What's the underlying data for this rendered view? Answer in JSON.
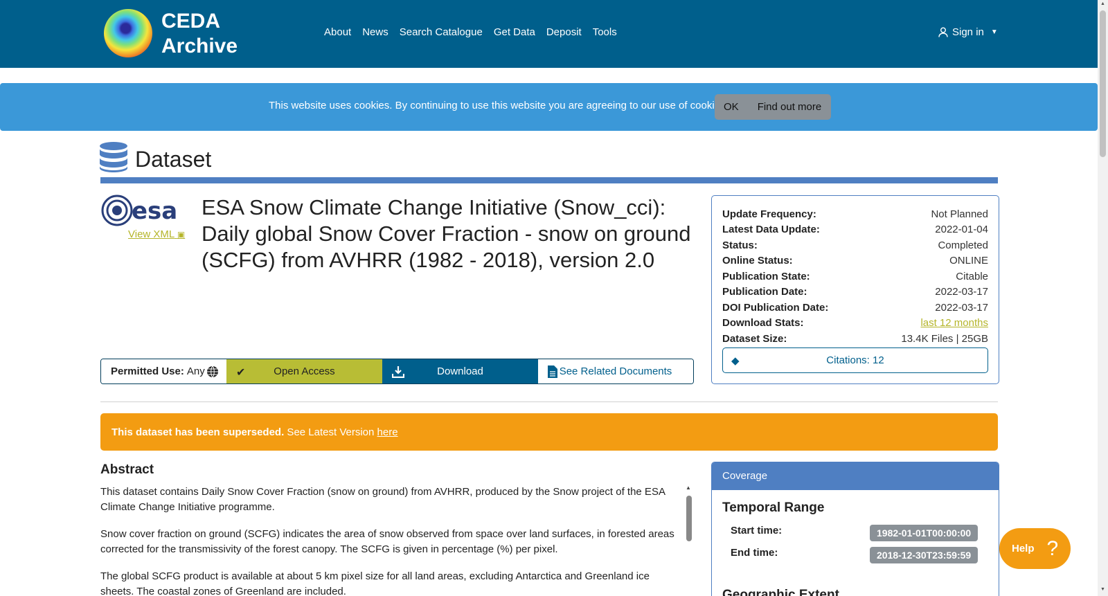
{
  "navbar": {
    "brand_line1": "CEDA",
    "brand_line2": "Archive",
    "links": [
      "About",
      "News",
      "Search Catalogue",
      "Get Data",
      "Deposit",
      "Tools"
    ],
    "signin": "Sign in"
  },
  "cookie": {
    "text": "This website uses cookies. By continuing to use this website you are agreeing to our use of cookies.",
    "ok": "OK",
    "find_out_more": "Find out more"
  },
  "dataset": {
    "heading": "Dataset",
    "view_xml": "View XML",
    "title": "ESA Snow Climate Change Initiative (Snow_cci): Daily global Snow Cover Fraction - snow on ground (SCFG) from AVHRR (1982 - 2018), version 2.0"
  },
  "actions": {
    "permitted_label": "Permitted Use:",
    "permitted_value": "Any",
    "open_access": "Open Access",
    "download": "Download",
    "related_docs": "See Related Documents"
  },
  "info": {
    "rows": [
      {
        "label": "Update Frequency:",
        "value": "Not Planned"
      },
      {
        "label": "Latest Data Update:",
        "value": "2022-01-04"
      },
      {
        "label": "Status:",
        "value": "Completed"
      },
      {
        "label": "Online Status:",
        "value": "ONLINE"
      },
      {
        "label": "Publication State:",
        "value": "Citable"
      },
      {
        "label": "Publication Date:",
        "value": "2022-03-17"
      },
      {
        "label": "DOI Publication Date:",
        "value": "2022-03-17"
      },
      {
        "label": "Download Stats:",
        "value": "last 12 months"
      },
      {
        "label": "Dataset Size:",
        "value": "13.4K Files | 25GB"
      }
    ],
    "citations": "Citations: 12"
  },
  "superseded": {
    "bold": "This dataset has been superseded.",
    "text": " See Latest Version ",
    "link": "here"
  },
  "abstract": {
    "heading": "Abstract",
    "paragraphs": [
      "This dataset contains Daily Snow Cover Fraction (snow on ground) from AVHRR, produced by the Snow project of the ESA Climate Change Initiative programme.",
      "Snow cover fraction on ground (SCFG) indicates the area of snow observed from space over land surfaces, in forested areas corrected for the transmissivity of the forest canopy. The SCFG is given in percentage (%) per pixel.",
      "The global SCFG product is available at about 5 km pixel size for all land areas, excluding Antarctica and Greenland ice sheets. The coastal zones of Greenland are included."
    ]
  },
  "coverage": {
    "header": "Coverage",
    "temporal_heading": "Temporal Range",
    "start_label": "Start time:",
    "start_value": "1982-01-01T00:00:00",
    "end_label": "End time:",
    "end_value": "2018-12-30T23:59:59",
    "geo_heading": "Geographic Extent"
  },
  "help": {
    "label": "Help",
    "icon": "?"
  }
}
